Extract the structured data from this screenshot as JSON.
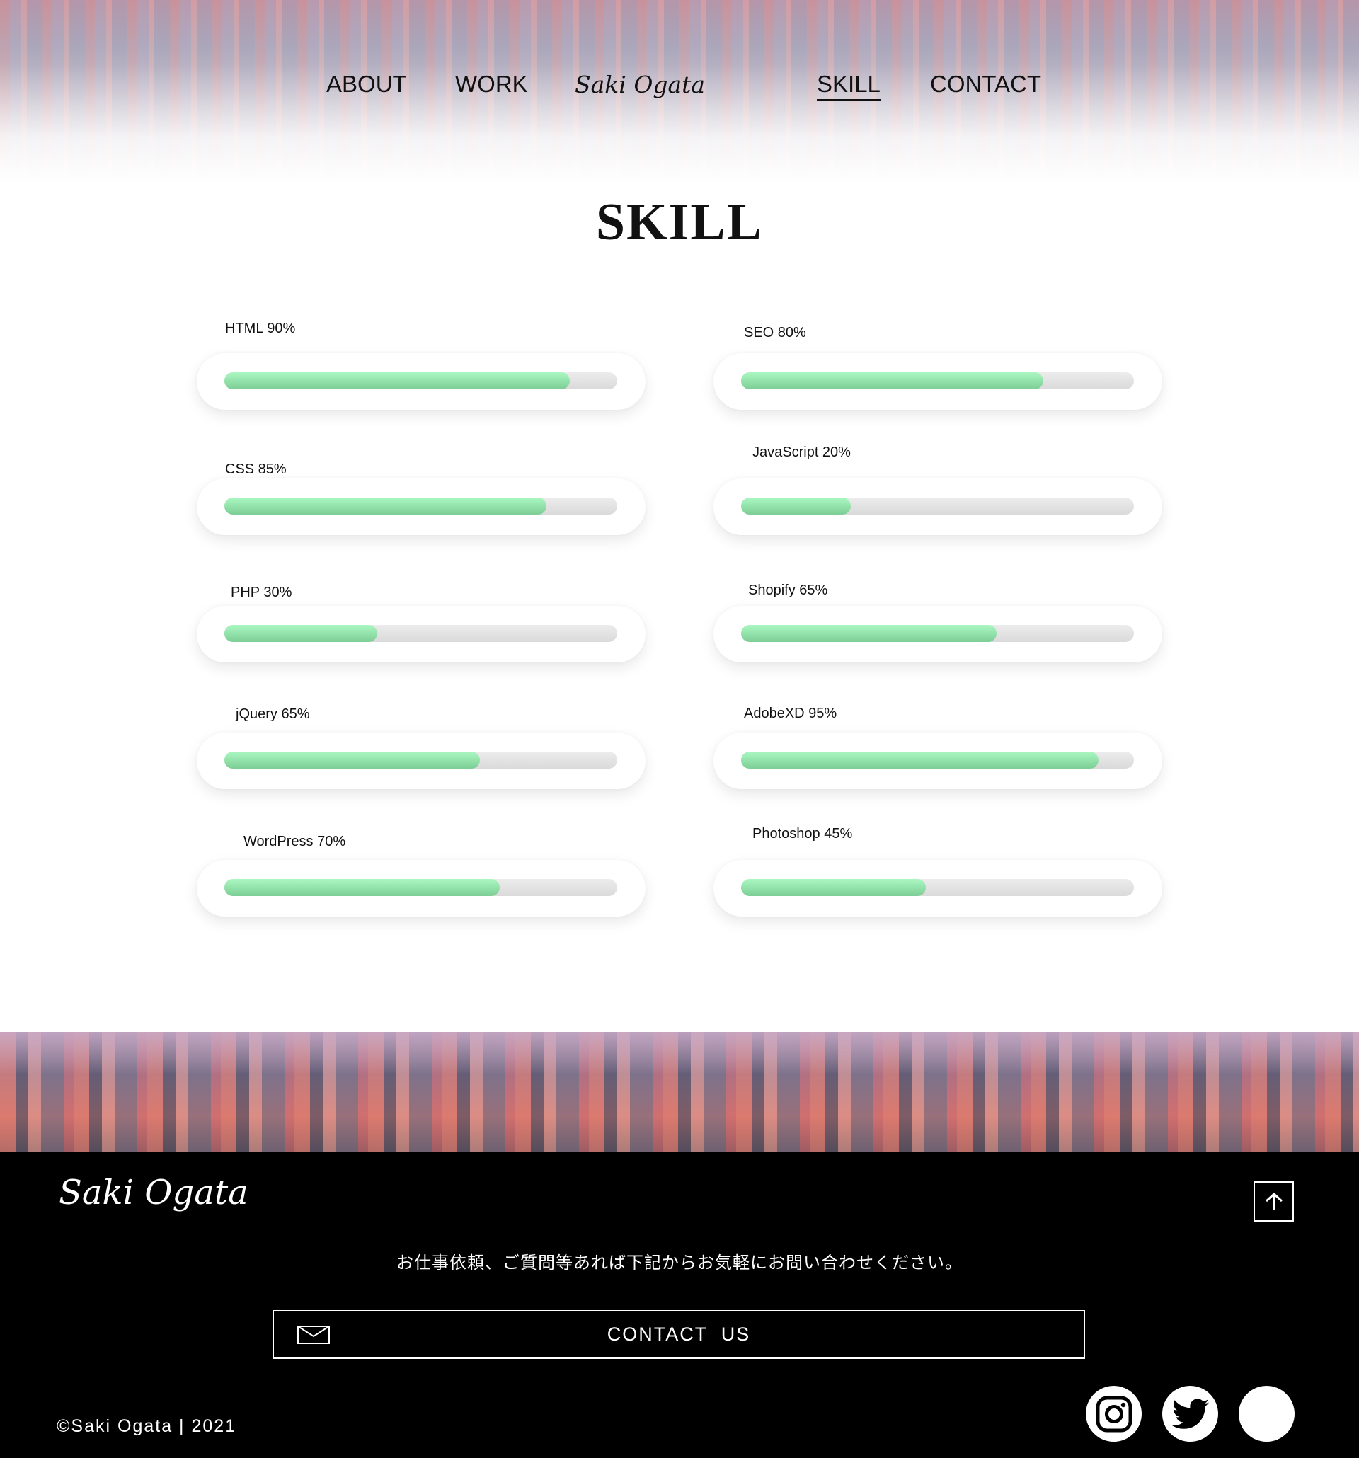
{
  "header": {
    "logo": "Saki Ogata",
    "nav": [
      {
        "label": "ABOUT"
      },
      {
        "label": "WORK"
      },
      {
        "label": "SKILL",
        "active": true
      },
      {
        "label": "CONTACT"
      }
    ]
  },
  "main": {
    "title": "SKILL",
    "skills_left": [
      {
        "label": "HTML 90%",
        "fill": 0.88
      },
      {
        "label": "CSS 85%",
        "fill": 0.82
      },
      {
        "label": "PHP 30%",
        "fill": 0.39
      },
      {
        "label": "jQuery 65%",
        "fill": 0.65
      },
      {
        "label": "WordPress 70%",
        "fill": 0.7
      }
    ],
    "skills_right": [
      {
        "label": "SEO 80%",
        "fill": 0.77
      },
      {
        "label": "JavaScript 20%",
        "fill": 0.28
      },
      {
        "label": "Shopify 65%",
        "fill": 0.65
      },
      {
        "label": "AdobeXD 95%",
        "fill": 0.91
      },
      {
        "label": "Photoshop 45%",
        "fill": 0.47
      }
    ],
    "colors": {
      "fill": "#8fe0a8",
      "track": "#e2e2e2"
    }
  },
  "footer": {
    "logo": "Saki Ogata",
    "message": "お仕事依頼、ご質問等あれば下記からお気軽にお問い合わせください。",
    "contact_button": "CONTACT  US",
    "copyright": "©Saki Ogata | 2021",
    "social": [
      {
        "icon": "instagram-icon"
      },
      {
        "icon": "twitter-icon"
      },
      {
        "icon": "blank-social-icon"
      }
    ]
  }
}
